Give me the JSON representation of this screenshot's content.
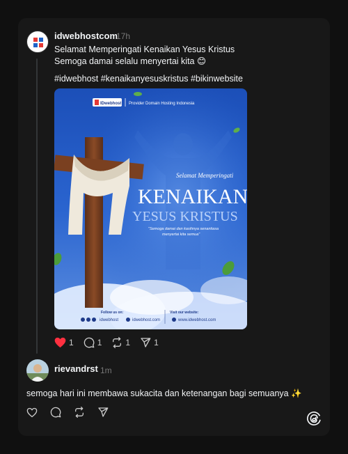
{
  "post": {
    "username": "idwebhostcom",
    "time": "17h",
    "line1": "Selamat Memperingati Kenaikan Yesus Kristus",
    "line2": "Semoga damai selalu menyertai kita 😊",
    "hashtags": "#idwebhost #kenaikanyesuskristus #bikinwebsite",
    "image": {
      "logo_text": "IDwebhost",
      "tagline": "Provider Domain Hosting Indonesia",
      "overline": "Selamat Memperingati",
      "title_big": "KENAIKAN",
      "title_sub": "YESUS KRISTUS",
      "quote1": "\"Semoga damai dan kasihnya senantiasa",
      "quote2": "menyertai kita semua\"",
      "follow_label": "Follow us on:",
      "social_handle": "idwebhost",
      "visit_label": "Visit our website:",
      "handle2": "idwebhost.com",
      "website": "www.idwebhost.com"
    },
    "likes": "1",
    "comments": "1",
    "reposts": "1",
    "shares": "1",
    "liked_color": "#ff3040"
  },
  "reply": {
    "username": "rievandrst",
    "time": "1m",
    "text": "semoga hari ini membawa sukacita dan ketenangan bagi semuanya ✨"
  },
  "icons": [
    "heart-icon",
    "comment-icon",
    "repost-icon",
    "share-icon",
    "threads-logo-icon"
  ]
}
